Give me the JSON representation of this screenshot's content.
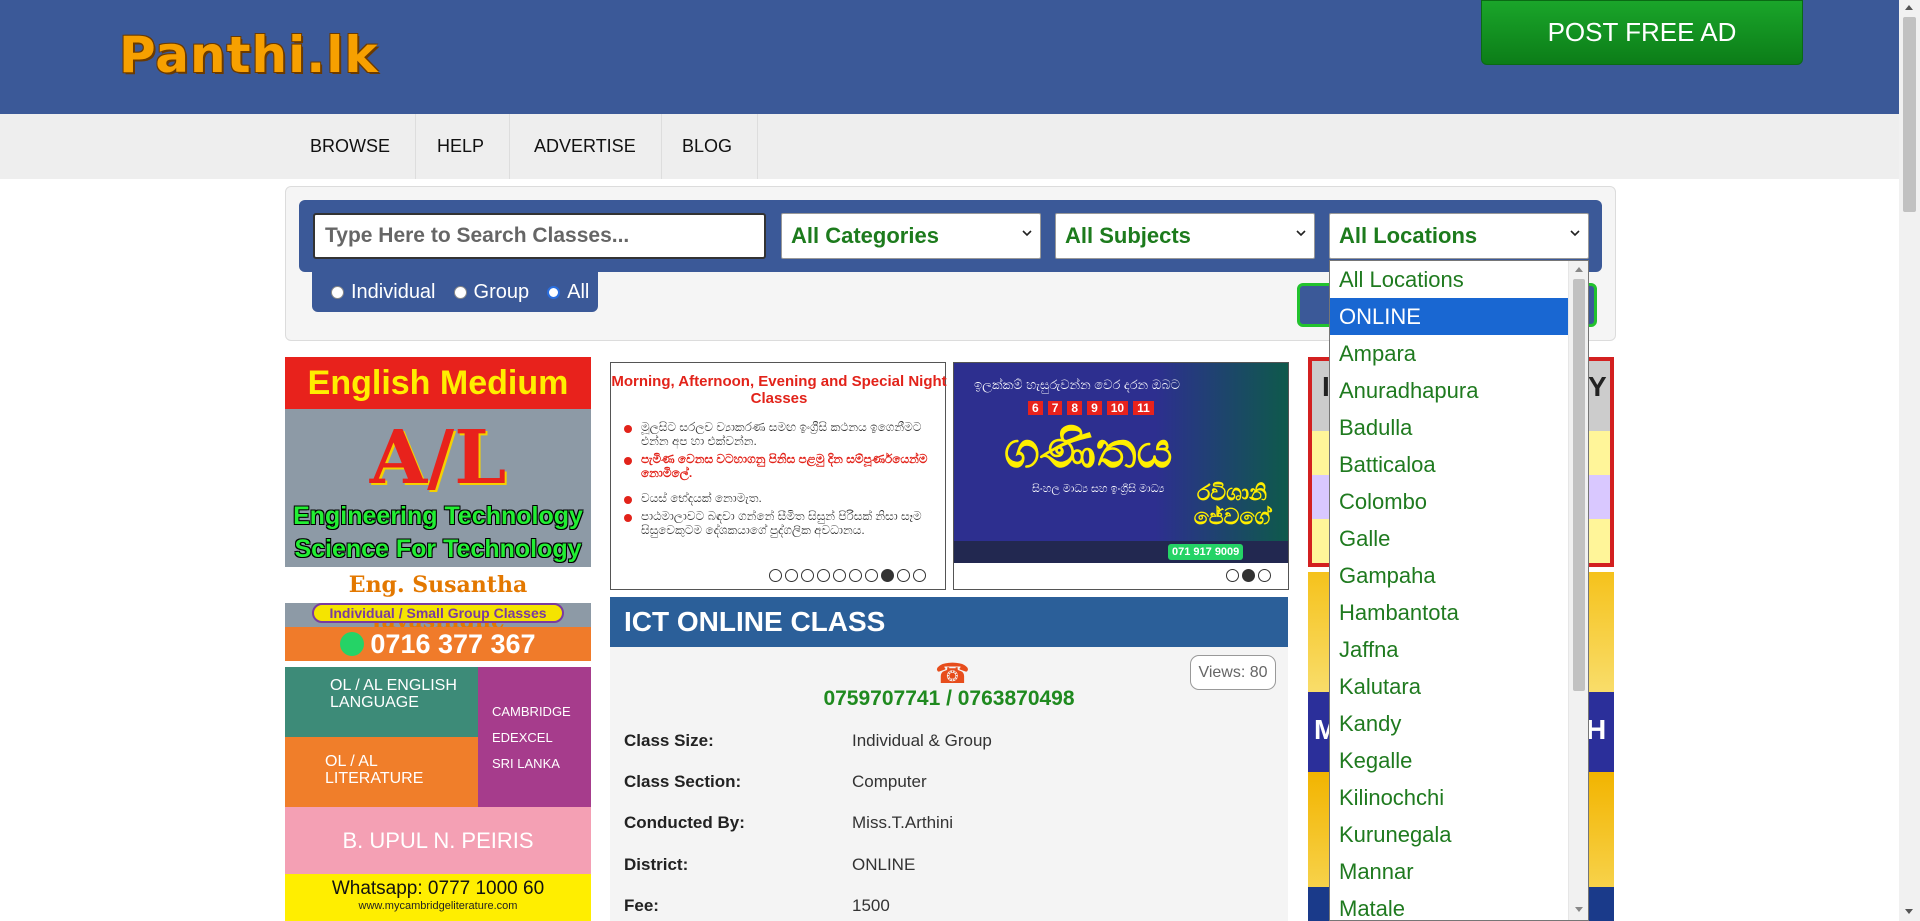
{
  "header": {
    "logo": "Panthi.lk",
    "post_ad_label": "POST FREE AD"
  },
  "nav": {
    "items": [
      "BROWSE",
      "HELP",
      "ADVERTISE",
      "BLOG"
    ]
  },
  "search": {
    "placeholder": "Type Here to Search Classes...",
    "categories_selected": "All Categories",
    "subjects_selected": "All Subjects",
    "locations_selected": "All Locations",
    "type_options": [
      "Individual",
      "Group",
      "All"
    ],
    "type_selected": "All"
  },
  "locations_dropdown": {
    "options": [
      "All Locations",
      "ONLINE",
      "Ampara",
      "Anuradhapura",
      "Badulla",
      "Batticaloa",
      "Colombo",
      "Galle",
      "Gampaha",
      "Hambantota",
      "Jaffna",
      "Kalutara",
      "Kandy",
      "Kegalle",
      "Kilinochchi",
      "Kurunegala",
      "Mannar",
      "Matale"
    ],
    "highlighted": "ONLINE"
  },
  "ads": {
    "english_medium": {
      "heading": "English Medium",
      "level": "A/L",
      "line1": "Engineering Technology",
      "line2": "Science For Technology",
      "name": "Eng. Susantha Jayasinghe",
      "pill": "Individual / Small Group Classes",
      "phone": "0716 377 367"
    },
    "cambridge": {
      "block1": "OL / AL ENGLISH LANGUAGE",
      "block2": "OL / AL LITERATURE",
      "boards": [
        "CAMBRIDGE",
        "EDEXCEL",
        "SRI LANKA"
      ],
      "name": "B. UPUL N. PEIRIS",
      "whatsapp": "Whatsapp: 0777 1000 60",
      "url": "www.mycambridgeliterature.com"
    }
  },
  "banner1": {
    "title": "Morning, Afternoon, Evening and Special Night Classes",
    "lines": [
      "මූලසිට සරලව ව්‍යාකරණ සමඟ ඉංග්‍රීසි කථනය ඉගෙනීමට එන්න අප හා එක්වන්න.",
      "පැමිණ වෙනස වටහාගනු පිනිස පළමු දින සම්පූර්ණයෙන්ම නොමිලේ.",
      "වයස් භේදයක් නොමැත.",
      "පාඨමාලාවට බඳවා ගන්නේ සීමිත සිසුන් පිරිසක් නිසා සෑම සිසුවෙකුටම දේශකයාගේ පුද්ගලික අවධානය."
    ]
  },
  "banner2": {
    "subtitle": "ඉලක්කම් හැසුරුවන්න වෙර දරන ඔබට",
    "grades": [
      "6",
      "7",
      "8",
      "9",
      "10",
      "11"
    ],
    "title": "ගණිතය",
    "medium": "සිංහල මාධ්‍ය සහ ඉංග්‍රීසි මාධ්‍ය",
    "teacher": "රවිශානි ජේවගේ",
    "phone": "071 917 9009"
  },
  "class": {
    "title": "ICT ONLINE CLASS",
    "views": "Views: 80",
    "phone_icon": "☎",
    "phones": "0759707741 / 0763870498",
    "details": [
      {
        "label": "Class Size:",
        "value": "Individual & Group"
      },
      {
        "label": "Class Section:",
        "value": "Computer"
      },
      {
        "label": "Conducted By:",
        "value": "Miss.T.Arthini"
      },
      {
        "label": "District:",
        "value": "ONLINE"
      },
      {
        "label": "Fee:",
        "value": "1500"
      }
    ]
  },
  "right_ads": {
    "letters": [
      "I",
      "Y"
    ],
    "big_letters": [
      "M",
      "H"
    ]
  },
  "colors": {
    "header_bg": "#3b5998",
    "accent_green": "#1f8a1f",
    "dropdown_highlight": "#1967d2"
  }
}
